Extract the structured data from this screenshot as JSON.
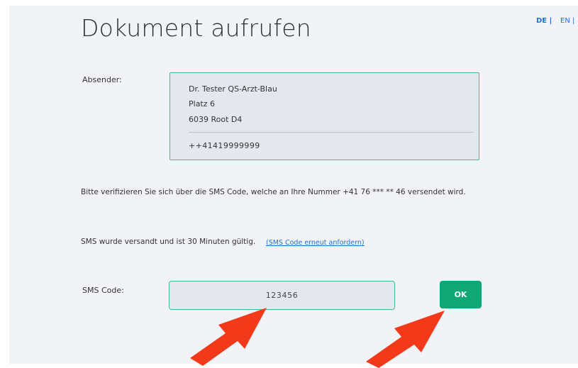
{
  "header": {
    "title": "Dokument aufrufen",
    "lang_de": "DE |",
    "lang_en": "EN |"
  },
  "sender": {
    "label": "Absender:",
    "name": "Dr. Tester QS-Arzt-Blau",
    "street": "Platz 6",
    "city": "6039  Root D4",
    "phone": "++41419999999"
  },
  "verification": {
    "instruction": "Bitte verifizieren Sie sich über die SMS Code, welche an Ihre Nummer +41 76 *** ** 46 versendet wird.",
    "sent_notice": "SMS wurde versandt und ist 30 Minuten gültig.",
    "resend_link": "(SMS Code erneut anfordern)"
  },
  "sms_form": {
    "label": "SMS Code:",
    "code_value": "123456",
    "ok_label": "OK"
  },
  "colors": {
    "accent_green": "#0fa774",
    "border_green": "#3fbf8a",
    "link_blue": "#1e6fd9",
    "annotation_arrow": "#f23a1a"
  },
  "icons": {
    "arrow_left": "red-arrow-annotation",
    "arrow_right": "red-arrow-annotation"
  }
}
